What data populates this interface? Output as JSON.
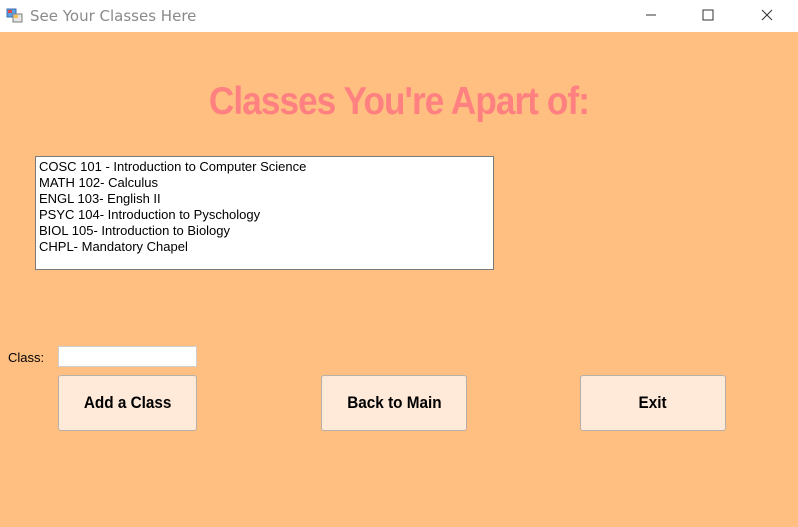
{
  "window": {
    "title": "See Your Classes Here"
  },
  "heading": "Classes You're Apart of:",
  "classes_list": [
    "COSC 101 - Introduction to Computer Science",
    "MATH 102- Calculus",
    "ENGL 103- English II",
    "PSYC 104- Introduction to Pyschology",
    "BIOL 105- Introduction to Biology",
    "CHPL- Mandatory Chapel"
  ],
  "class_field": {
    "label": "Class:",
    "value": ""
  },
  "buttons": {
    "add": "Add a Class",
    "back": "Back to Main",
    "exit": "Exit"
  },
  "colors": {
    "background": "#ffbf80",
    "heading": "#ff8080",
    "button": "#ffe9d9"
  }
}
